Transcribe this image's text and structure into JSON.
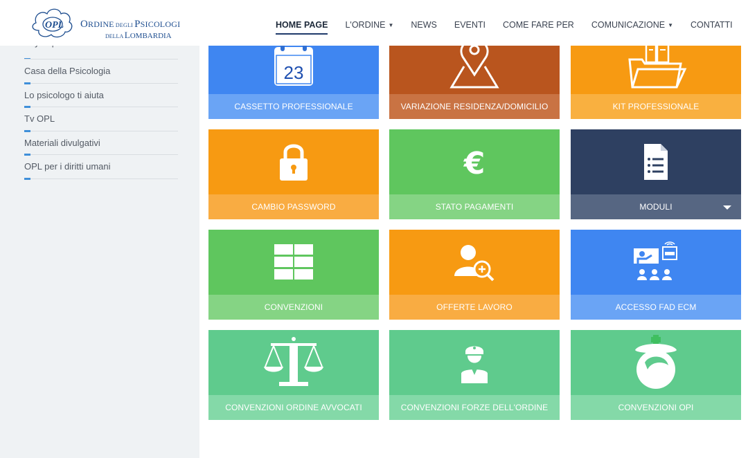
{
  "header": {
    "logo": {
      "line1_a": "O",
      "line1_b": "RDINE",
      "line1_c": " DEGLI ",
      "line1_d": "P",
      "line1_e": "SICOLOGI",
      "line2_a": "DELLA ",
      "line2_b": "L",
      "line2_c": "OMBARDIA"
    },
    "nav": [
      {
        "label": "HOME PAGE",
        "active": true
      },
      {
        "label": "L'ORDINE",
        "dropdown": true
      },
      {
        "label": "NEWS"
      },
      {
        "label": "EVENTI"
      },
      {
        "label": "COME FARE PER"
      },
      {
        "label": "COMUNICAZIONE",
        "dropdown": true
      },
      {
        "label": "CONTATTI"
      }
    ]
  },
  "sidebar": {
    "items": [
      {
        "label": "Psymap"
      },
      {
        "label": "Casa della Psicologia"
      },
      {
        "label": "Lo psicologo ti aiuta"
      },
      {
        "label": "Tv OPL"
      },
      {
        "label": "Materiali divulgativi"
      },
      {
        "label": "OPL per i diritti umani"
      }
    ]
  },
  "tiles": [
    {
      "label": "CASSETTO PROFESSIONALE",
      "icon": "calendar-icon",
      "calendar_day": "23",
      "color": "#3f86f1",
      "label_color": "#6aa4f5"
    },
    {
      "label": "VARIAZIONE RESIDENZA/DOMICILIO",
      "icon": "map-pin-icon",
      "color": "#b9551e",
      "label_color": "#c97343"
    },
    {
      "label": "KIT PROFESSIONALE",
      "icon": "folder-icon",
      "color": "#f79a12",
      "label_color": "#f9b040"
    },
    {
      "label": "CAMBIO PASSWORD",
      "icon": "padlock-icon",
      "color": "#f79a12",
      "label_color": "#f9ac42"
    },
    {
      "label": "STATO PAGAMENTI",
      "icon": "euro-icon",
      "color": "#5fc65e",
      "label_color": "#85d484"
    },
    {
      "label": "MODULI",
      "icon": "document-list-icon",
      "color": "#2e4061",
      "label_color": "#566682",
      "dropdown": true
    },
    {
      "label": "CONVENZIONI",
      "icon": "grid-icon",
      "color": "#5fc65e",
      "label_color": "#85d484"
    },
    {
      "label": "OFFERTE LAVORO",
      "icon": "user-search-icon",
      "color": "#f79a12",
      "label_color": "#f9ac42"
    },
    {
      "label": "ACCESSO FAD ECM",
      "icon": "online-class-icon",
      "color": "#3f86f1",
      "label_color": "#6aa4f5"
    },
    {
      "label": "CONVENZIONI ORDINE AVVOCATI",
      "icon": "scales-icon",
      "color": "#5fcb8d",
      "label_color": "#84d9a8"
    },
    {
      "label": "CONVENZIONI FORZE DELL'ORDINE",
      "icon": "officer-icon",
      "color": "#5fcb8d",
      "label_color": "#84d9a8"
    },
    {
      "label": "CONVENZIONI OPI",
      "icon": "nurse-icon",
      "color": "#5fcb8d",
      "label_color": "#84d9a8"
    }
  ]
}
